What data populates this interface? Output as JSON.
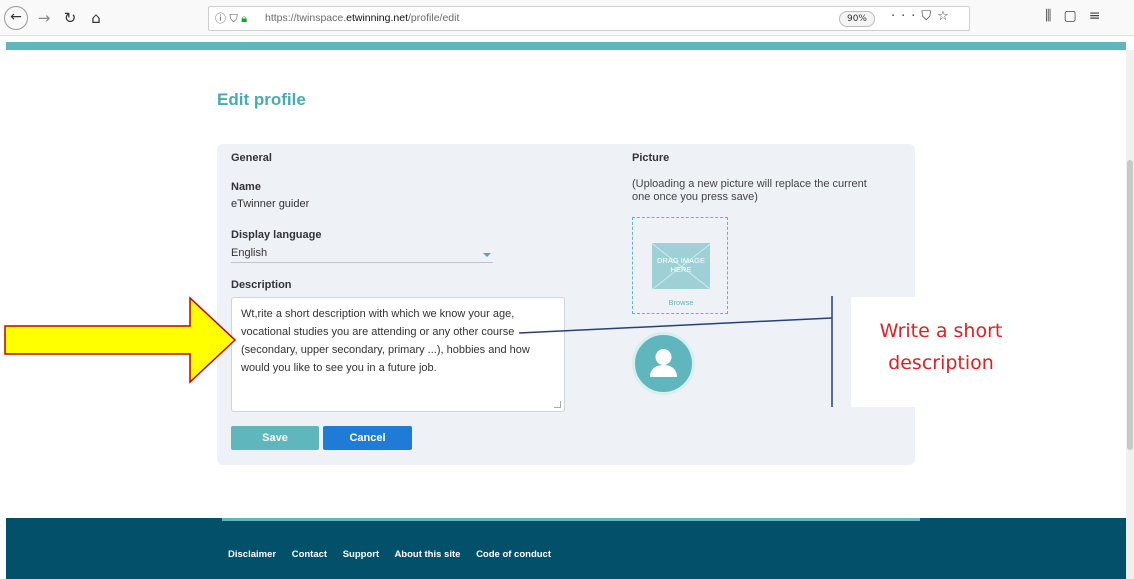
{
  "browser": {
    "url_prefix": "https://twinspace.",
    "url_domain": "etwinning.net",
    "url_path": "/profile/edit",
    "zoom": "90%"
  },
  "page": {
    "title": "Edit profile"
  },
  "general": {
    "heading": "General",
    "name_label": "Name",
    "name_value": "eTwinner guider",
    "language_label": "Display language",
    "language_value": "English",
    "description_label": "Description",
    "description_text": "Wt,rite a short description with which we know your age, vocational studies you are attending or any other course (secondary, upper secondary, primary ...), hobbies and how would you like to see you in a future job.",
    "save_label": "Save",
    "cancel_label": "Cancel"
  },
  "picture": {
    "heading": "Picture",
    "hint": "(Uploading a new picture will replace the current one once you press save)",
    "drop_text": "DRAG IMAGE HERE",
    "browse_label": "Browse"
  },
  "annotation": {
    "callout_text": "Write a short description",
    "arrow_color": "#ffff00",
    "arrow_border": "#c00000",
    "callout_color": "#e02020"
  },
  "footer": {
    "links": [
      "Disclaimer",
      "Contact",
      "Support",
      "About this site",
      "Code of conduct"
    ]
  },
  "colors": {
    "accent": "#5fb6bd",
    "title": "#4aaab3",
    "cancel": "#1f7bd6",
    "footer": "#03506b"
  }
}
